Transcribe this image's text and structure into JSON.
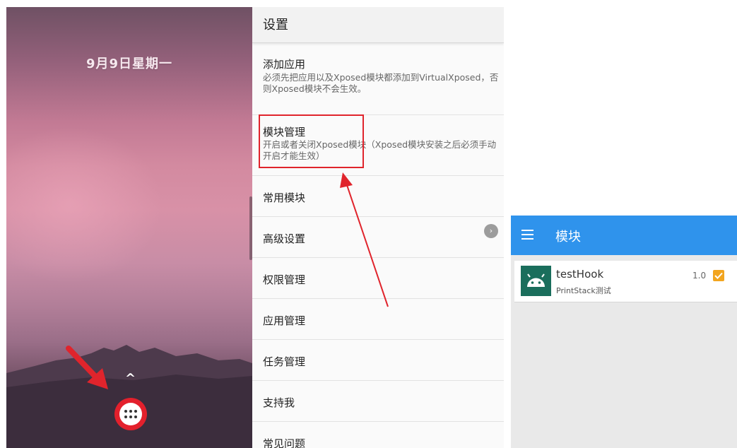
{
  "home": {
    "date": "9月9日星期一",
    "drawer_label": "⠿"
  },
  "settings": {
    "title": "设置",
    "items": [
      {
        "title": "添加应用",
        "subtitle": "必须先把应用以及Xposed模块都添加到VirtualXposed，否则Xposed模块不会生效。"
      },
      {
        "title": "模块管理",
        "subtitle": "开启或者关闭Xposed模块（Xposed模块安装之后必须手动开启才能生效）"
      },
      {
        "title": "常用模块"
      },
      {
        "title": "高级设置"
      },
      {
        "title": "权限管理"
      },
      {
        "title": "应用管理"
      },
      {
        "title": "任务管理"
      },
      {
        "title": "支持我"
      },
      {
        "title": "常见问题"
      }
    ]
  },
  "modules": {
    "title": "模块",
    "items": [
      {
        "name": "testHook",
        "description": "PrintStack测试",
        "version": "1.0",
        "enabled": true
      }
    ]
  },
  "colors": {
    "accent_red": "#e0242c",
    "toolbar_blue": "#2f93ec",
    "checkbox_orange": "#f2a51f",
    "app_icon_green": "#1a6e5c"
  }
}
